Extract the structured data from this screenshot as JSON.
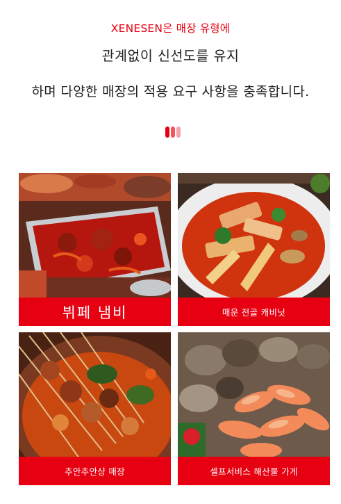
{
  "intro": {
    "line1": "XENESEN은 매장 유형에",
    "line2": "관계없이 신선도를 유지",
    "line3": "하며 다양한 매장의 적용 요구 사항을 충족합니다."
  },
  "colors": {
    "accent": "#e60012",
    "dots": [
      "#e60012",
      "#f2545f",
      "#f7a2a8"
    ]
  },
  "cards": [
    {
      "label": "뷔페 냄비",
      "image": "hotpot-buffet-photo"
    },
    {
      "label": "매운 전골 캐비닛",
      "image": "spicy-hotpot-photo"
    },
    {
      "label": "추안추안샹 매장",
      "image": "skewer-hotpot-photo"
    },
    {
      "label": "셀프서비스 해산물 가게",
      "image": "seafood-shrimp-photo"
    }
  ]
}
